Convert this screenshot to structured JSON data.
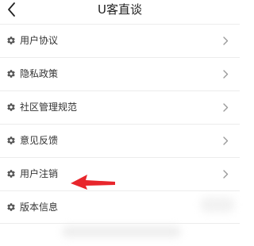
{
  "header": {
    "title": "U客直谈",
    "back_icon": "chevron-left-icon"
  },
  "menu": {
    "items": [
      {
        "label": "用户协议",
        "icon": "gear-icon",
        "has_chevron": true
      },
      {
        "label": "隐私政策",
        "icon": "gear-icon",
        "has_chevron": true
      },
      {
        "label": "社区管理规范",
        "icon": "gear-icon",
        "has_chevron": true
      },
      {
        "label": "意见反馈",
        "icon": "gear-icon",
        "has_chevron": true
      },
      {
        "label": "用户注销",
        "icon": "gear-icon",
        "has_chevron": true
      },
      {
        "label": "版本信息",
        "icon": "gear-icon",
        "has_chevron": false
      }
    ]
  },
  "annotation": {
    "arrow_color": "#e8262c",
    "points_to": "用户注销"
  }
}
